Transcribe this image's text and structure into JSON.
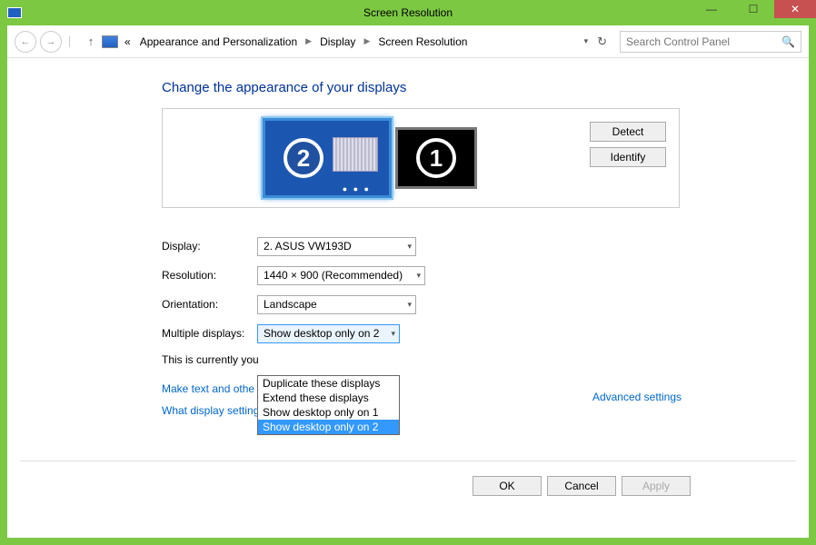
{
  "titlebar": {
    "title": "Screen Resolution"
  },
  "breadcrumb": {
    "prefix": "«",
    "items": [
      "Appearance and Personalization",
      "Display",
      "Screen Resolution"
    ]
  },
  "search": {
    "placeholder": "Search Control Panel"
  },
  "page": {
    "heading": "Change the appearance of your displays",
    "detect": "Detect",
    "identify": "Identify",
    "monitor2_num": "2",
    "monitor1_num": "1"
  },
  "form": {
    "display_label": "Display:",
    "display_value": "2. ASUS VW193D",
    "resolution_label": "Resolution:",
    "resolution_value": "1440 × 900 (Recommended)",
    "orientation_label": "Orientation:",
    "orientation_value": "Landscape",
    "multiple_label": "Multiple displays:",
    "multiple_value": "Show desktop only on 2",
    "multiple_options": [
      "Duplicate these displays",
      "Extend these displays",
      "Show desktop only on 1",
      "Show desktop only on 2"
    ],
    "note_prefix": "This is currently you",
    "link1_prefix": "Make text and othe",
    "link2": "What display settings should I choose?",
    "advanced": "Advanced settings"
  },
  "buttons": {
    "ok": "OK",
    "cancel": "Cancel",
    "apply": "Apply"
  }
}
